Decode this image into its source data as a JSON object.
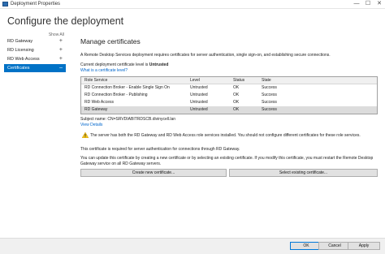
{
  "window": {
    "title": "Deployment Properties",
    "controls": {
      "minimize": "—",
      "maximize": "☐",
      "close": "✕"
    }
  },
  "header": {
    "title": "Configure the deployment"
  },
  "sidebar": {
    "show_all": "Show All",
    "items": [
      {
        "label": "RD Gateway",
        "marker": "+"
      },
      {
        "label": "RD Licensing",
        "marker": "+"
      },
      {
        "label": "RD Web Access",
        "marker": "+"
      },
      {
        "label": "Certificates",
        "marker": "–",
        "active": true
      }
    ]
  },
  "main": {
    "heading": "Manage certificates",
    "description": "A Remote Desktop Services deployment requires certificates for server authentication, single sign-on, and establishing secure connections.",
    "level_label": "Current deployment certificate level is",
    "level_value": "Untrusted",
    "level_link": "What is a certificate level?",
    "table": {
      "columns": [
        "Role Service",
        "Level",
        "Status",
        "State"
      ],
      "rows": [
        [
          "RD Connection Broker - Enable Single Sign On",
          "Untrusted",
          "OK",
          "Success"
        ],
        [
          "RD Connection Broker - Publishing",
          "Untrusted",
          "OK",
          "Success"
        ],
        [
          "RD Web Access",
          "Untrusted",
          "OK",
          "Success"
        ],
        [
          "RD Gateway",
          "Untrusted",
          "OK",
          "Success"
        ]
      ]
    },
    "subject": "Subject name: CN=SRVDIABITRDSCB.divinycell.lan",
    "view_details": "View Details",
    "warning": "The server has both the RD Gateway and RD Web Access role services installed. You should not configure different certificates for these role services.",
    "required": "This certificate is required for server authentication for connections through RD Gateway.",
    "update": "You can update this certificate by creating a new certificate or by selecting an existing certificate. If you modify this certificate, you must restart the Remote Desktop Gateway service on all RD Gateway servers.",
    "create_button": "Create new certificate...",
    "select_button": "Select existing certificate..."
  },
  "footer": {
    "ok": "OK",
    "cancel": "Cancel",
    "apply": "Apply"
  },
  "colors": {
    "accent": "#0072c6",
    "link": "#0066cc",
    "warning": "#f5c518"
  }
}
